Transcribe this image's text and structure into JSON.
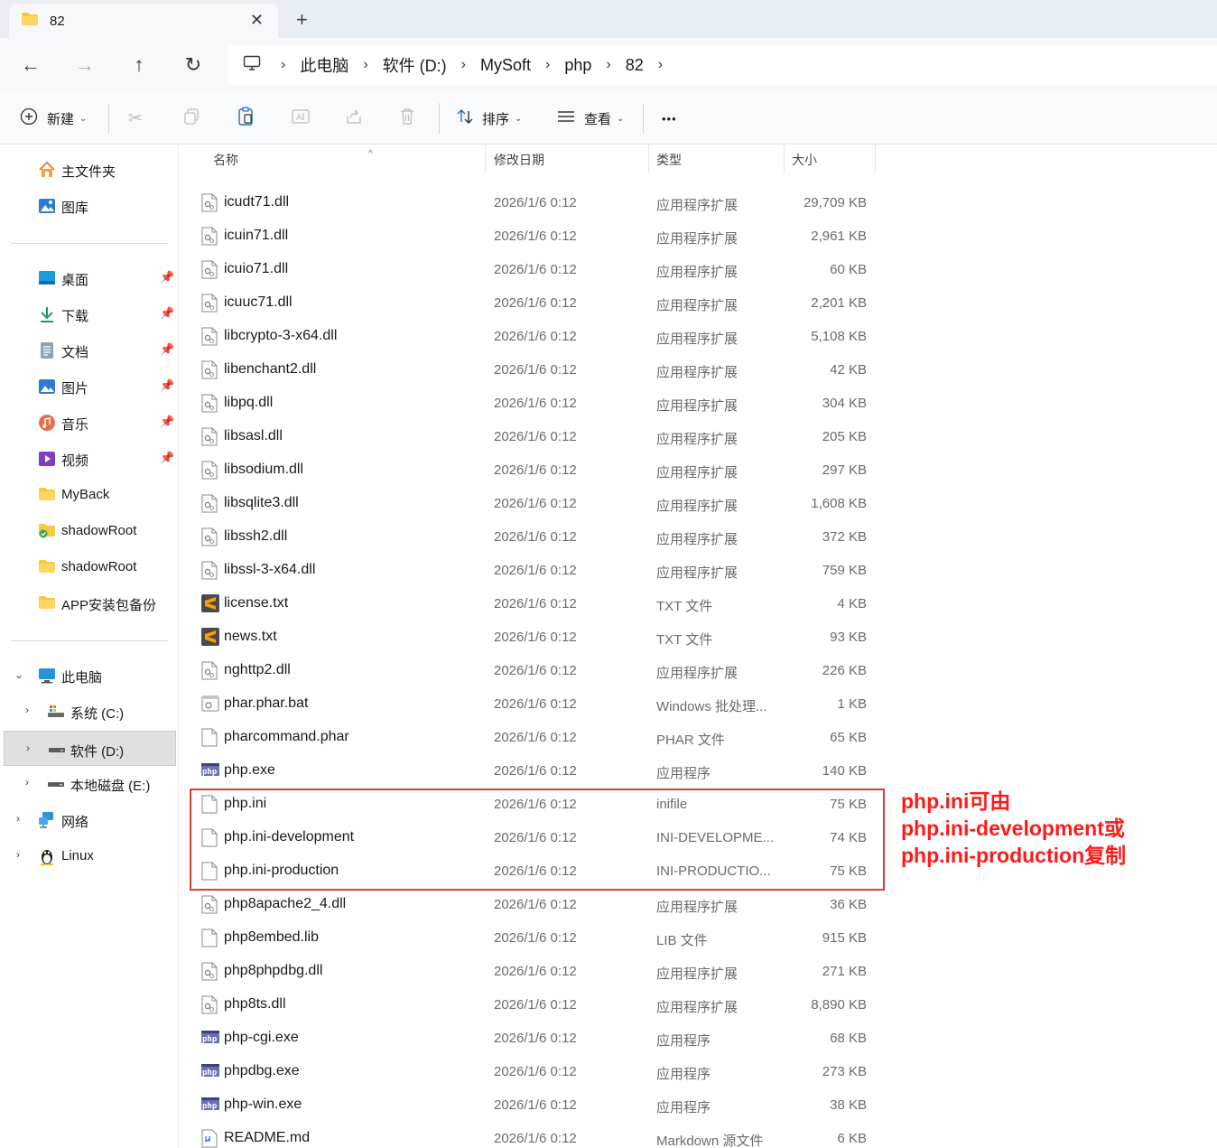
{
  "window": {
    "tab_title": "82",
    "tab_close": "✕",
    "new_tab": "+"
  },
  "nav": {
    "back": "←",
    "forward": "→",
    "up": "↑",
    "refresh": "↻"
  },
  "breadcrumb": {
    "items": [
      "此电脑",
      "软件 (D:)",
      "MySoft",
      "php",
      "82"
    ]
  },
  "toolbar": {
    "new_label": "新建",
    "sort_label": "排序",
    "view_label": "查看",
    "more_label": "•••"
  },
  "sidebar": {
    "top": [
      {
        "label": "主文件夹",
        "icon": "home-icon"
      },
      {
        "label": "图库",
        "icon": "gallery-icon"
      }
    ],
    "quick": [
      {
        "label": "桌面",
        "icon": "desktop-icon",
        "pinned": true
      },
      {
        "label": "下载",
        "icon": "download-icon",
        "pinned": true
      },
      {
        "label": "文档",
        "icon": "document-icon",
        "pinned": true
      },
      {
        "label": "图片",
        "icon": "pictures-icon",
        "pinned": true
      },
      {
        "label": "音乐",
        "icon": "music-icon",
        "pinned": true
      },
      {
        "label": "视频",
        "icon": "video-icon",
        "pinned": true
      },
      {
        "label": "MyBack",
        "icon": "folder-icon",
        "pinned": false
      },
      {
        "label": "shadowRoot",
        "icon": "folder-sync-icon",
        "pinned": false
      },
      {
        "label": "shadowRoot",
        "icon": "folder-icon",
        "pinned": false
      },
      {
        "label": "APP安装包备份",
        "icon": "folder-icon",
        "pinned": false
      }
    ],
    "tree": {
      "this_pc": "此电脑",
      "drives": [
        {
          "label": "系统 (C:)",
          "selected": false
        },
        {
          "label": "软件 (D:)",
          "selected": true
        },
        {
          "label": "本地磁盘 (E:)",
          "selected": false
        }
      ],
      "network": "网络",
      "linux": "Linux"
    }
  },
  "columns": {
    "name": "名称",
    "date": "修改日期",
    "type": "类型",
    "size": "大小"
  },
  "files": [
    {
      "name": "icudt71.dll",
      "date": "2026/1/6 0:12",
      "type": "应用程序扩展",
      "size": "29,709 KB",
      "icon": "dll"
    },
    {
      "name": "icuin71.dll",
      "date": "2026/1/6 0:12",
      "type": "应用程序扩展",
      "size": "2,961 KB",
      "icon": "dll"
    },
    {
      "name": "icuio71.dll",
      "date": "2026/1/6 0:12",
      "type": "应用程序扩展",
      "size": "60 KB",
      "icon": "dll"
    },
    {
      "name": "icuuc71.dll",
      "date": "2026/1/6 0:12",
      "type": "应用程序扩展",
      "size": "2,201 KB",
      "icon": "dll"
    },
    {
      "name": "libcrypto-3-x64.dll",
      "date": "2026/1/6 0:12",
      "type": "应用程序扩展",
      "size": "5,108 KB",
      "icon": "dll"
    },
    {
      "name": "libenchant2.dll",
      "date": "2026/1/6 0:12",
      "type": "应用程序扩展",
      "size": "42 KB",
      "icon": "dll"
    },
    {
      "name": "libpq.dll",
      "date": "2026/1/6 0:12",
      "type": "应用程序扩展",
      "size": "304 KB",
      "icon": "dll"
    },
    {
      "name": "libsasl.dll",
      "date": "2026/1/6 0:12",
      "type": "应用程序扩展",
      "size": "205 KB",
      "icon": "dll"
    },
    {
      "name": "libsodium.dll",
      "date": "2026/1/6 0:12",
      "type": "应用程序扩展",
      "size": "297 KB",
      "icon": "dll"
    },
    {
      "name": "libsqlite3.dll",
      "date": "2026/1/6 0:12",
      "type": "应用程序扩展",
      "size": "1,608 KB",
      "icon": "dll"
    },
    {
      "name": "libssh2.dll",
      "date": "2026/1/6 0:12",
      "type": "应用程序扩展",
      "size": "372 KB",
      "icon": "dll"
    },
    {
      "name": "libssl-3-x64.dll",
      "date": "2026/1/6 0:12",
      "type": "应用程序扩展",
      "size": "759 KB",
      "icon": "dll"
    },
    {
      "name": "license.txt",
      "date": "2026/1/6 0:12",
      "type": "TXT 文件",
      "size": "4 KB",
      "icon": "txt"
    },
    {
      "name": "news.txt",
      "date": "2026/1/6 0:12",
      "type": "TXT 文件",
      "size": "93 KB",
      "icon": "txt"
    },
    {
      "name": "nghttp2.dll",
      "date": "2026/1/6 0:12",
      "type": "应用程序扩展",
      "size": "226 KB",
      "icon": "dll"
    },
    {
      "name": "phar.phar.bat",
      "date": "2026/1/6 0:12",
      "type": "Windows 批处理...",
      "size": "1 KB",
      "icon": "bat"
    },
    {
      "name": "pharcommand.phar",
      "date": "2026/1/6 0:12",
      "type": "PHAR 文件",
      "size": "65 KB",
      "icon": "blank"
    },
    {
      "name": "php.exe",
      "date": "2026/1/6 0:12",
      "type": "应用程序",
      "size": "140 KB",
      "icon": "php"
    },
    {
      "name": "php.ini",
      "date": "2026/1/6 0:12",
      "type": "inifile",
      "size": "75 KB",
      "icon": "blank"
    },
    {
      "name": "php.ini-development",
      "date": "2026/1/6 0:12",
      "type": "INI-DEVELOPME...",
      "size": "74 KB",
      "icon": "blank"
    },
    {
      "name": "php.ini-production",
      "date": "2026/1/6 0:12",
      "type": "INI-PRODUCTIO...",
      "size": "75 KB",
      "icon": "blank"
    },
    {
      "name": "php8apache2_4.dll",
      "date": "2026/1/6 0:12",
      "type": "应用程序扩展",
      "size": "36 KB",
      "icon": "dll"
    },
    {
      "name": "php8embed.lib",
      "date": "2026/1/6 0:12",
      "type": "LIB 文件",
      "size": "915 KB",
      "icon": "blank"
    },
    {
      "name": "php8phpdbg.dll",
      "date": "2026/1/6 0:12",
      "type": "应用程序扩展",
      "size": "271 KB",
      "icon": "dll"
    },
    {
      "name": "php8ts.dll",
      "date": "2026/1/6 0:12",
      "type": "应用程序扩展",
      "size": "8,890 KB",
      "icon": "dll"
    },
    {
      "name": "php-cgi.exe",
      "date": "2026/1/6 0:12",
      "type": "应用程序",
      "size": "68 KB",
      "icon": "php"
    },
    {
      "name": "phpdbg.exe",
      "date": "2026/1/6 0:12",
      "type": "应用程序",
      "size": "273 KB",
      "icon": "php"
    },
    {
      "name": "php-win.exe",
      "date": "2026/1/6 0:12",
      "type": "应用程序",
      "size": "38 KB",
      "icon": "php"
    },
    {
      "name": "README.md",
      "date": "2026/1/6 0:12",
      "type": "Markdown 源文件",
      "size": "6 KB",
      "icon": "md"
    }
  ],
  "annotation": {
    "lines": [
      "php.ini可由",
      "php.ini-development或",
      "php.ini-production复制"
    ],
    "color": "#ff1a1a"
  },
  "colors": {
    "accent": "#0067c0",
    "folder": "#f8c93e",
    "highlight_border": "#e53935"
  }
}
